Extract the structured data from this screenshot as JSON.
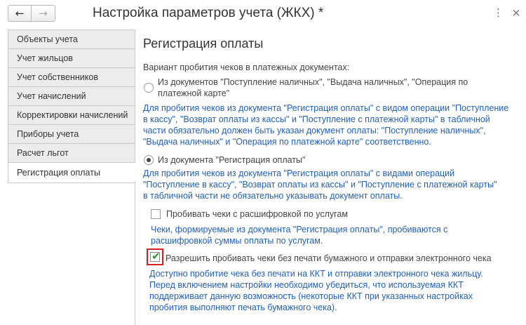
{
  "window": {
    "title": "Настройка параметров учета (ЖКХ) *",
    "back_glyph": "←",
    "forward_glyph": "→",
    "menu_glyph": "⋮",
    "close_glyph": "×"
  },
  "tabs": [
    {
      "label": "Объекты учета",
      "active": false
    },
    {
      "label": "Учет жильцов",
      "active": false
    },
    {
      "label": "Учет собственников",
      "active": false
    },
    {
      "label": "Учет начислений",
      "active": false
    },
    {
      "label": "Корректировки начислений",
      "active": false
    },
    {
      "label": "Приборы учета",
      "active": false
    },
    {
      "label": "Расчет льгот",
      "active": false
    },
    {
      "label": "Регистрация оплаты",
      "active": true
    }
  ],
  "section": {
    "title": "Регистрация оплаты",
    "variant_label": "Вариант пробития чеков в платежных документах:",
    "option1": {
      "line1": "Из документов \"Поступление наличных\", \"Выдача наличных\", \"Операция по",
      "line2": "платежной карте\"",
      "selected": false,
      "hint": [
        "Для пробития чеков из документа \"Регистрация оплаты\" с видом операции \"Поступление",
        "в кассу\", \"Возврат оплаты из кассы\" и \"Поступление с платежной карты\" в табличной",
        "части обязательно должен быть указан документ оплаты: \"Поступление наличных\",",
        "\"Выдача наличных\" и \"Операция по платежной карте\" соответственно."
      ]
    },
    "option2": {
      "label": "Из документа \"Регистрация оплаты\"",
      "selected": true,
      "hint": [
        "Для пробития чеков из документа \"Регистрация оплаты\" с видами операций",
        "\"Поступление в кассу\", \"Возврат оплаты из кассы\" и \"Поступление с платежной карты\"",
        "в табличной части не обязательно указывать документ оплаты."
      ]
    },
    "checkbox1": {
      "label": "Пробивать чеки с расшифровкой по услугам",
      "checked": false,
      "hint": [
        "Чеки, формируемые из документа \"Регистрация оплаты\", пробиваются с",
        "расшифровкой суммы оплаты по услугам."
      ]
    },
    "checkbox2": {
      "label": "Разрешить пробивать чеки без печати бумажного и отправки электронного чека",
      "checked": true,
      "check_glyph": "✔",
      "hint": [
        "Доступно пробитие чека без печати на ККТ и отправки электронного чека жильцу.",
        "Перед включением настройки необходимо убедиться, что используемая ККТ",
        "поддерживает данную возможность (некоторые ККТ при указанных настройках",
        "пробития выполняют печать бумажного чека)."
      ]
    }
  },
  "colors": {
    "hint_text": "#1f5fbf",
    "highlight": "#d92020",
    "check": "#2a9a2a"
  }
}
